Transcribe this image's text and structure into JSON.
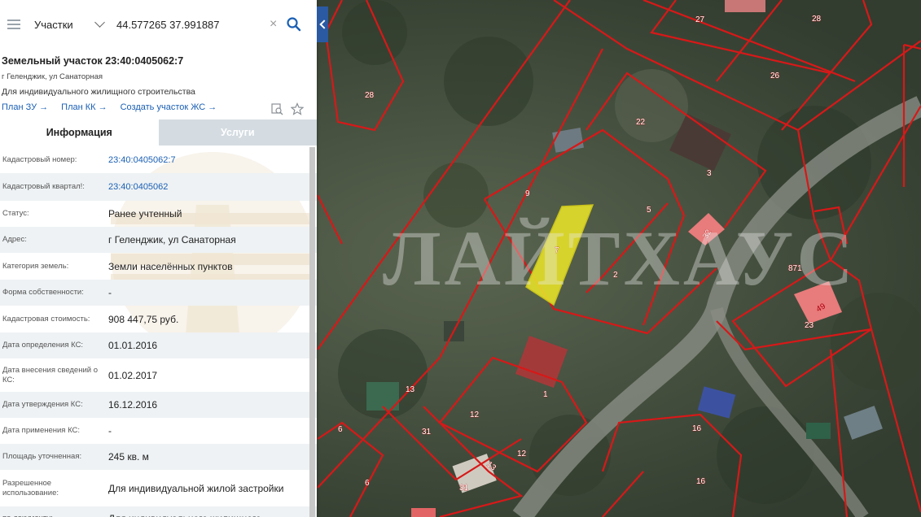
{
  "search": {
    "type_label": "Участки",
    "query": "44.577265 37.991887",
    "clear_glyph": "×"
  },
  "plot": {
    "title": "Земельный участок 23:40:0405062:7",
    "address": "г Геленджик, ул Санаторная",
    "purpose": "Для индивидуального жилищного строительства",
    "links": [
      "План ЗУ",
      "План КК",
      "Создать участок ЖС"
    ]
  },
  "tabs": {
    "info": "Информация",
    "services": "Услуги"
  },
  "info_rows": [
    {
      "label": "Кадастровый номер:",
      "value": "23:40:0405062:7",
      "link": true
    },
    {
      "label": "Кадастровый квартал!:",
      "value": "23:40:0405062",
      "link": true
    },
    {
      "label": "Статус:",
      "value": "Ранее учтенный"
    },
    {
      "label": "Адрес:",
      "value": "г Геленджик, ул Санаторная"
    },
    {
      "label": "Категория земель:",
      "value": "Земли населённых пунктов"
    },
    {
      "label": "Форма собственности:",
      "value": "-"
    },
    {
      "label": "Кадастровая стоимость:",
      "value": "908 447,75 руб."
    },
    {
      "label": "Дата определения КС:",
      "value": "01.01.2016"
    },
    {
      "label": "Дата внесения сведений о КС:",
      "value": "01.02.2017"
    },
    {
      "label": "Дата утверждения КС:",
      "value": "16.12.2016"
    },
    {
      "label": "Дата применения КС:",
      "value": "-"
    },
    {
      "label": "Площадь уточненная:",
      "value": "245 кв. м"
    },
    {
      "label": "Разрешенное использование:",
      "value": "Для индивидуальной жилой застройки"
    },
    {
      "label": "по документу:",
      "value": "Для индивидуального жилищного"
    }
  ],
  "map": {
    "watermark": "ЛАЙТХАУС",
    "plot_numbers": [
      "27",
      "28",
      "28",
      "26",
      "22",
      "3",
      "9",
      "5",
      "7",
      "32",
      "2",
      "871",
      "49",
      "23",
      "1",
      "13",
      "12",
      "12",
      "13",
      "6",
      "31",
      "31",
      "6",
      "16",
      "16"
    ],
    "colors": {
      "boundary": "#d81818",
      "highlight": "#e8e22a",
      "accent": "#2b5aa3"
    }
  }
}
